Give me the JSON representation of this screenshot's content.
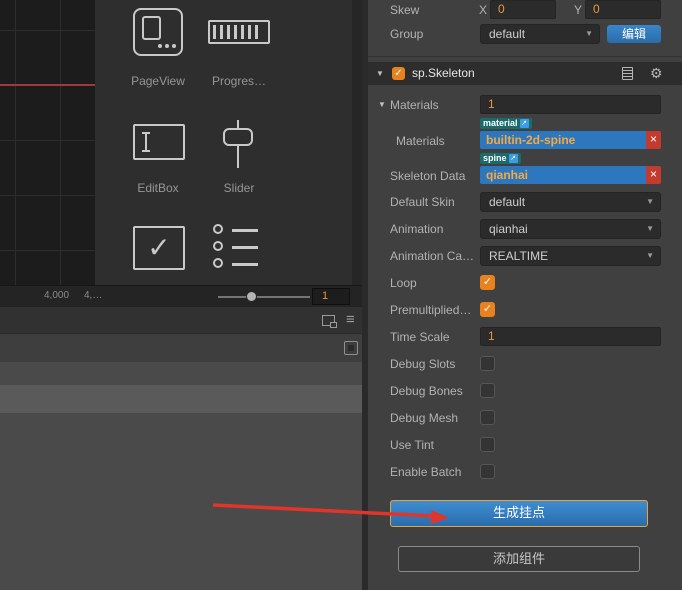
{
  "colors": {
    "accent_orange": "#e8963c",
    "asset_blue": "#2d77be",
    "tag_teal": "#1b6b6b",
    "danger_red": "#c23b2e",
    "button_blue": "#2f7cc0",
    "focus_orange": "#e8a33d",
    "arrow_red": "#e3342a"
  },
  "scene": {
    "ruler_label_1": "4,000",
    "ruler_label_2": "4,…"
  },
  "widget_panel": {
    "items": [
      {
        "label": "PageView"
      },
      {
        "label": "Progres…"
      },
      {
        "label": "EditBox"
      },
      {
        "label": "Slider"
      }
    ]
  },
  "zoom_control": {
    "value": "1"
  },
  "inspector": {
    "skew": {
      "label": "Skew",
      "x_label": "X",
      "x_value": "0",
      "y_label": "Y",
      "y_value": "0"
    },
    "group": {
      "label": "Group",
      "value": "default",
      "edit_button": "编辑"
    },
    "component": {
      "name": "sp.Skeleton",
      "enabled": true
    },
    "materials_count": {
      "label": "Materials",
      "value": "1"
    },
    "materials_field": {
      "label": "Materials",
      "tag": "material",
      "value": "builtin-2d-spine"
    },
    "skeleton_data": {
      "label": "Skeleton Data",
      "tag": "spine",
      "value": "qianhai"
    },
    "default_skin": {
      "label": "Default Skin",
      "value": "default"
    },
    "animation": {
      "label": "Animation",
      "value": "qianhai"
    },
    "animation_cache": {
      "label": "Animation Ca…",
      "value": "REALTIME"
    },
    "loop": {
      "label": "Loop",
      "checked": true
    },
    "premultiplied": {
      "label": "Premultiplied…",
      "checked": true
    },
    "time_scale": {
      "label": "Time Scale",
      "value": "1"
    },
    "debug_slots": {
      "label": "Debug Slots",
      "checked": false
    },
    "debug_bones": {
      "label": "Debug Bones",
      "checked": false
    },
    "debug_mesh": {
      "label": "Debug Mesh",
      "checked": false
    },
    "use_tint": {
      "label": "Use Tint",
      "checked": false
    },
    "enable_batch": {
      "label": "Enable Batch",
      "checked": false
    },
    "generate_button": "生成挂点",
    "add_component_button": "添加组件"
  }
}
